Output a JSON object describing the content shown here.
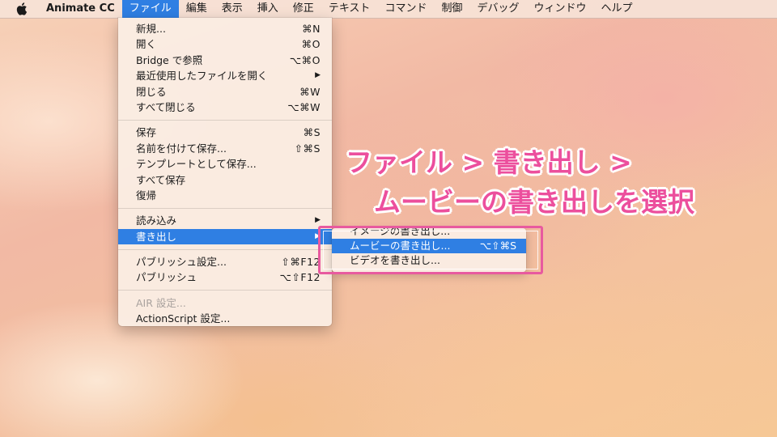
{
  "menubar": {
    "apple_icon": "apple-icon",
    "app_name": "Animate CC",
    "items": [
      "ファイル",
      "編集",
      "表示",
      "挿入",
      "修正",
      "テキスト",
      "コマンド",
      "制御",
      "デバッグ",
      "ウィンドウ",
      "ヘルプ"
    ]
  },
  "file_menu": {
    "groups": [
      [
        {
          "label": "新規...",
          "shortcut": "⌘N"
        },
        {
          "label": "開く",
          "shortcut": "⌘O"
        },
        {
          "label": "Bridge で参照",
          "shortcut": "⌥⌘O"
        },
        {
          "label": "最近使用したファイルを開く",
          "shortcut": "▶"
        },
        {
          "label": "閉じる",
          "shortcut": "⌘W"
        },
        {
          "label": "すべて閉じる",
          "shortcut": "⌥⌘W"
        }
      ],
      [
        {
          "label": "保存",
          "shortcut": "⌘S"
        },
        {
          "label": "名前を付けて保存...",
          "shortcut": "⇧⌘S"
        },
        {
          "label": "テンプレートとして保存...",
          "shortcut": ""
        },
        {
          "label": "すべて保存",
          "shortcut": ""
        },
        {
          "label": "復帰",
          "shortcut": ""
        }
      ],
      [
        {
          "label": "読み込み",
          "shortcut": "▶"
        },
        {
          "label": "書き出し",
          "shortcut": "▶"
        }
      ],
      [
        {
          "label": "パブリッシュ設定...",
          "shortcut": "⇧⌘F12"
        },
        {
          "label": "パブリッシュ",
          "shortcut": "⌥⇧F12"
        }
      ],
      [
        {
          "label": "AIR 設定...",
          "shortcut": ""
        },
        {
          "label": "ActionScript 設定...",
          "shortcut": ""
        }
      ]
    ]
  },
  "export_submenu": {
    "items": [
      {
        "label": "イメージの書き出し...",
        "shortcut": ""
      },
      {
        "label": "ムービーの書き出し...",
        "shortcut": "⌥⇧⌘S"
      },
      {
        "label": "ビデオを書き出し...",
        "shortcut": ""
      }
    ]
  },
  "annotation": {
    "line1": "ファイル > 書き出し >",
    "line2": "ムービーの書き出しを選択",
    "color": "#ec4f9d"
  },
  "colors": {
    "selection": "#2f7fe3",
    "frame": "#e85a9f"
  }
}
